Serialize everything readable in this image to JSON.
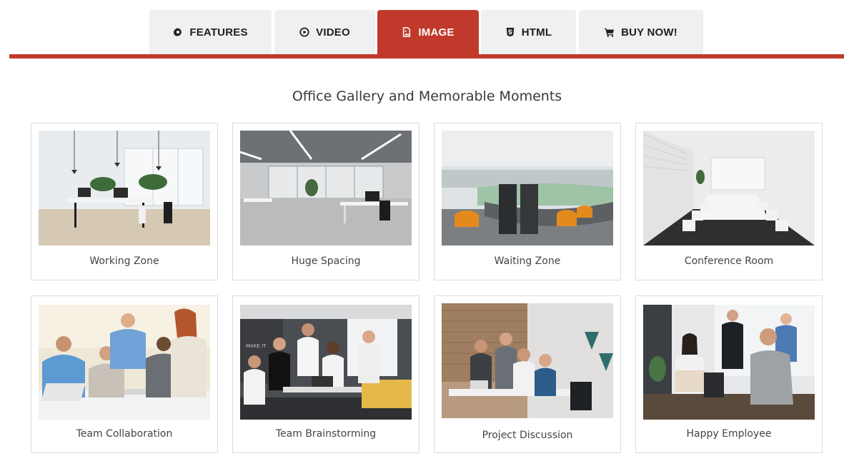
{
  "tabs": [
    {
      "label": "FEATURES",
      "icon": "gear-icon",
      "active": false
    },
    {
      "label": "VIDEO",
      "icon": "play-circle-icon",
      "active": false
    },
    {
      "label": "IMAGE",
      "icon": "image-icon",
      "active": true
    },
    {
      "label": "HTML",
      "icon": "html5-icon",
      "active": false
    },
    {
      "label": "BUY NOW!",
      "icon": "cart-icon",
      "active": false
    }
  ],
  "colors": {
    "accent": "#c0392b",
    "tab_bg": "#eef0f2"
  },
  "gallery": {
    "title": "Office Gallery and Memorable Moments",
    "items": [
      {
        "caption": "Working Zone"
      },
      {
        "caption": "Huge Spacing"
      },
      {
        "caption": "Waiting Zone"
      },
      {
        "caption": "Conference Room"
      },
      {
        "caption": "Team Collaboration"
      },
      {
        "caption": "Team Brainstorming"
      },
      {
        "caption": "Project Discussion"
      },
      {
        "caption": "Happy Employee"
      }
    ]
  }
}
